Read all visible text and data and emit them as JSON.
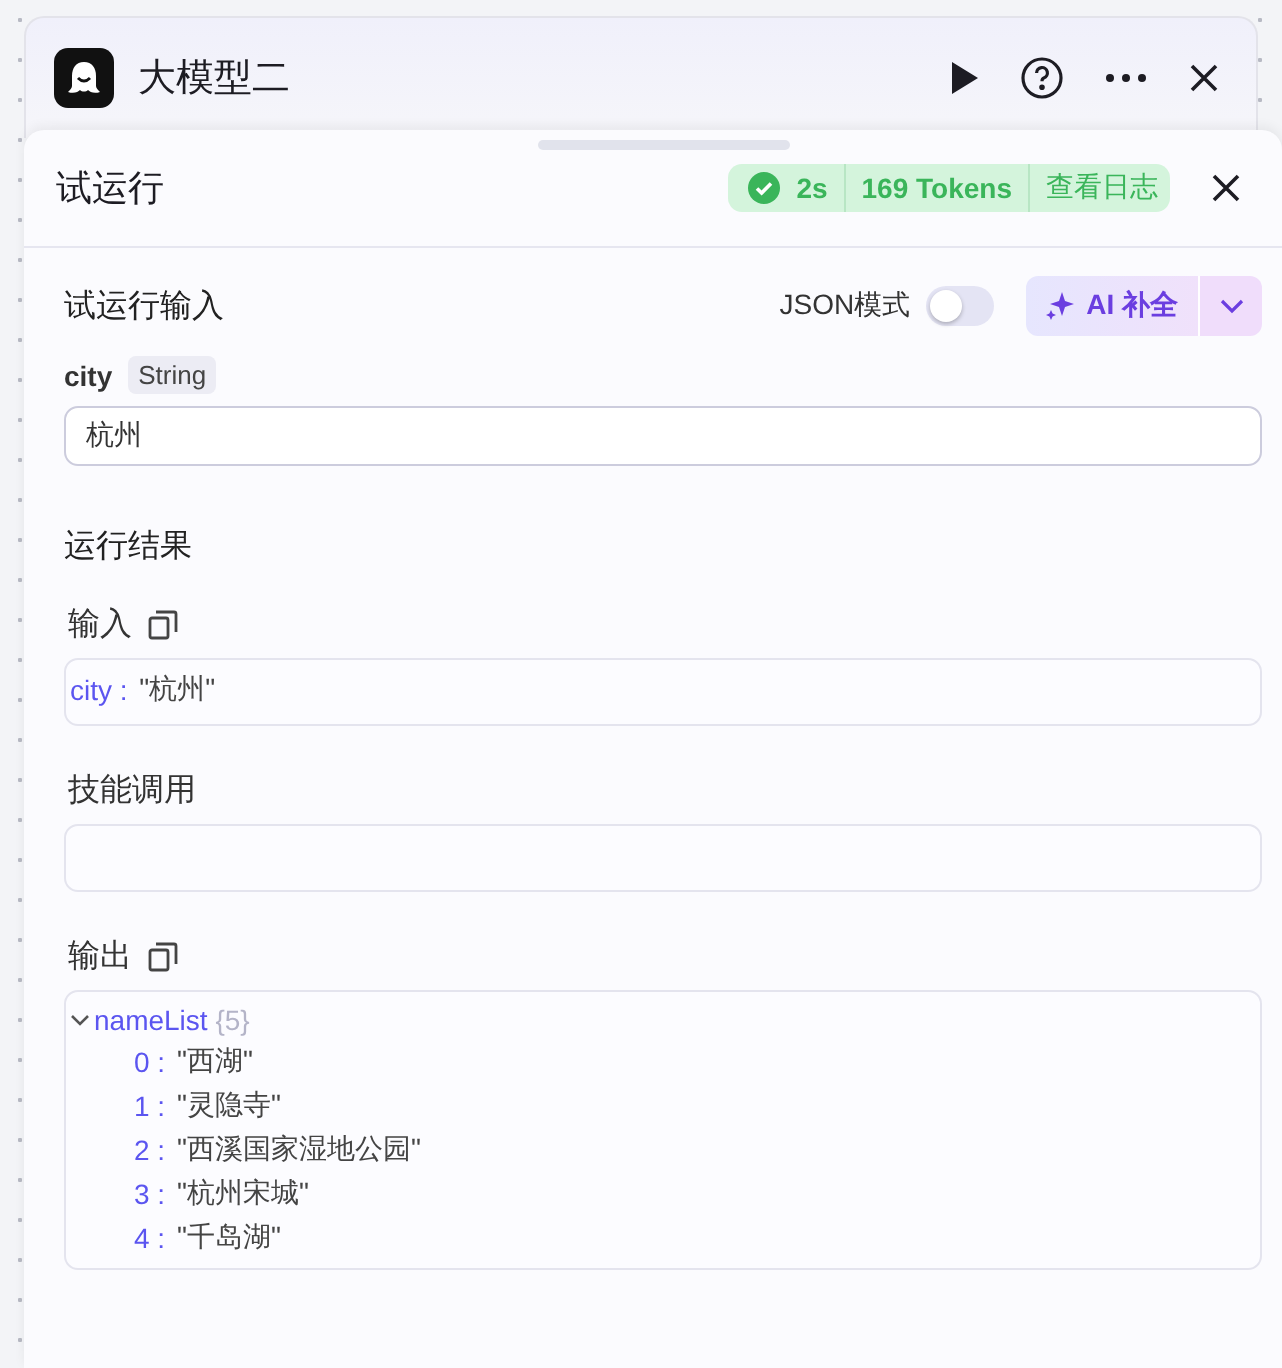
{
  "node": {
    "title": "大模型二"
  },
  "panel": {
    "title": "试运行",
    "status": {
      "duration": "2s",
      "tokens": "169 Tokens",
      "log_link": "查看日志"
    }
  },
  "test_input": {
    "title": "试运行输入",
    "json_mode": {
      "label": "JSON模式",
      "on": false
    },
    "ai_button": {
      "label": "AI 补全"
    },
    "fields": [
      {
        "name": "city",
        "type": "String",
        "value": "杭州"
      }
    ]
  },
  "results": {
    "title": "运行结果",
    "input": {
      "title": "输入",
      "entries": [
        {
          "key": "city :",
          "value": "\"杭州\""
        }
      ]
    },
    "skill_call": {
      "title": "技能调用"
    },
    "output": {
      "title": "输出",
      "root": {
        "key": "nameList",
        "count": "{5}",
        "expanded": true,
        "children": [
          {
            "key": "0 :",
            "value": "\"西湖\""
          },
          {
            "key": "1 :",
            "value": "\"灵隐寺\""
          },
          {
            "key": "2 :",
            "value": "\"西溪国家湿地公园\""
          },
          {
            "key": "3 :",
            "value": "\"杭州宋城\""
          },
          {
            "key": "4 :",
            "value": "\"千岛湖\""
          }
        ]
      }
    }
  }
}
